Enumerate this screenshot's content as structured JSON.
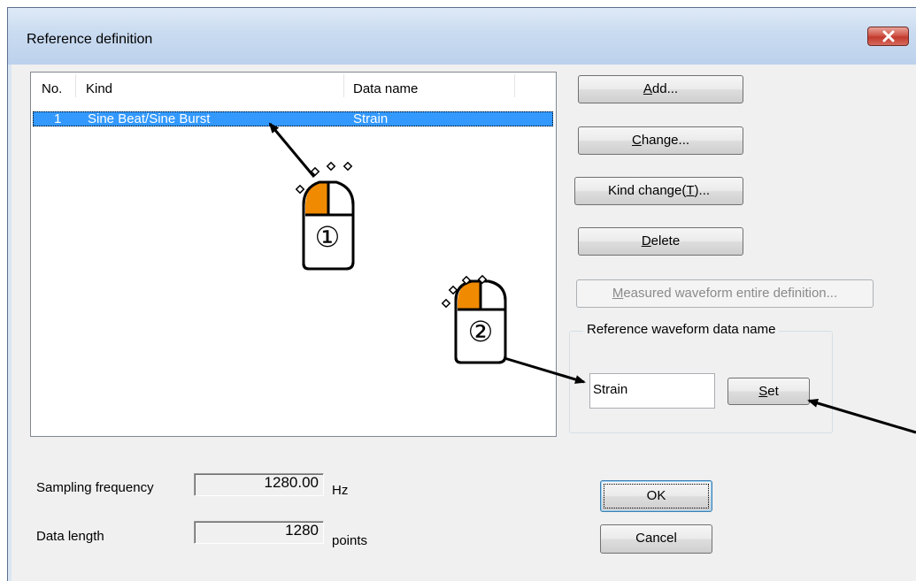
{
  "window": {
    "title": "Reference definition"
  },
  "list": {
    "columns": [
      "No.",
      "Kind",
      "Data name"
    ],
    "rows": [
      {
        "no": "1",
        "kind": "Sine Beat/Sine Burst",
        "data_name": "Strain"
      }
    ]
  },
  "buttons": {
    "add": {
      "label": "Add...",
      "mnemonic": "A",
      "rest": "dd..."
    },
    "change": {
      "label": "Change...",
      "mnemonic": "C",
      "rest": "hange..."
    },
    "kind_change": {
      "label": "Kind change(T)...",
      "pre": "Kind change(",
      "mnemonic": "T",
      "post": ")..."
    },
    "delete": {
      "label": "Delete",
      "mnemonic": "D",
      "rest": "elete"
    },
    "measured": {
      "label": "Measured waveform entire definition...",
      "mnemonic": "M",
      "rest": "easured waveform entire definition..."
    },
    "set": {
      "label": "Set",
      "mnemonic": "S",
      "rest": "et"
    },
    "ok": "OK",
    "cancel": "Cancel"
  },
  "reference_group": {
    "label": "Reference waveform data name",
    "value": "Strain"
  },
  "sampling": {
    "label": "Sampling frequency",
    "value": "1280.00",
    "unit": "Hz"
  },
  "data_length": {
    "label": "Data length",
    "value": "1280",
    "unit": "points"
  },
  "annotations": {
    "step1": "①",
    "step2": "②",
    "mouse_icon": "mouse-left-click-icon",
    "accent": "#f08a00"
  },
  "colors": {
    "selection": "#3399ff",
    "titlebar": "#c9dbf0",
    "close": "#c2392d"
  }
}
